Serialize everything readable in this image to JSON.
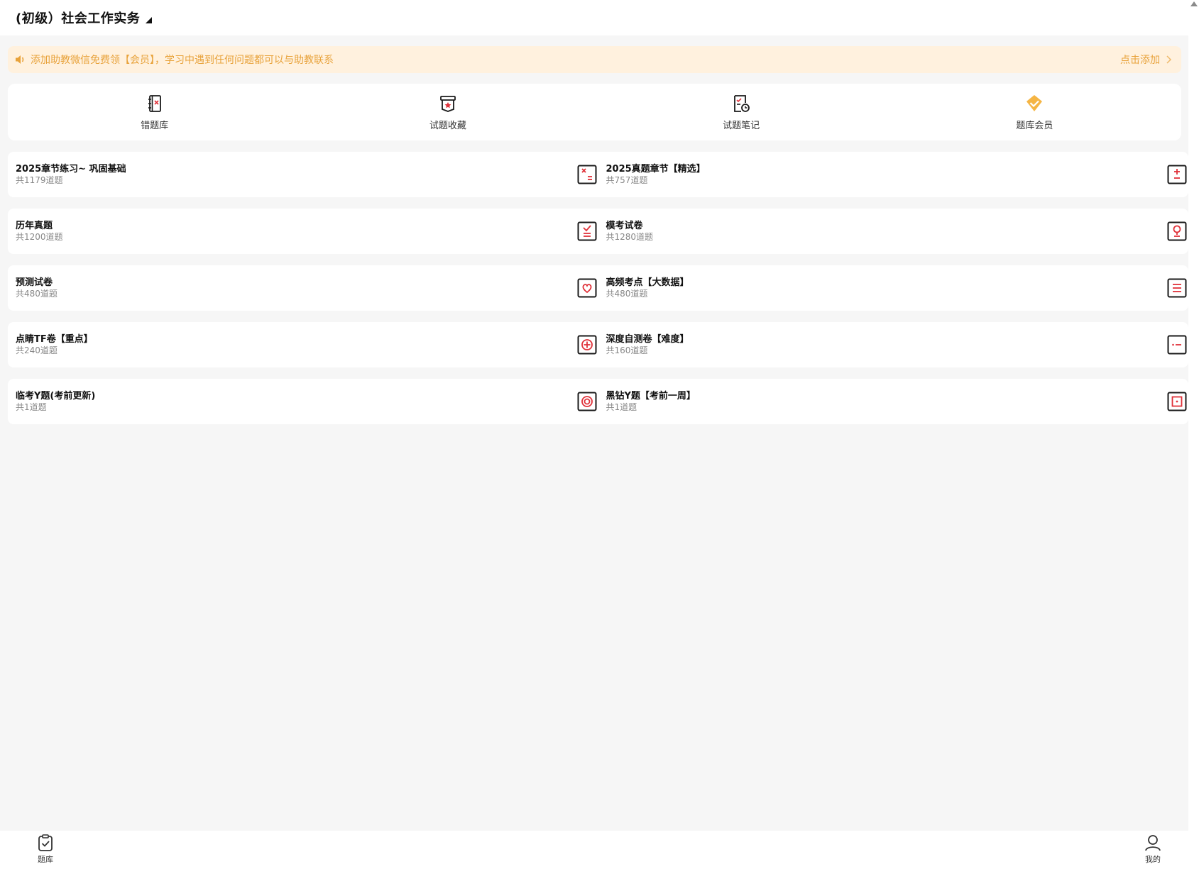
{
  "header": {
    "title": "(初级）社会工作实务"
  },
  "notice": {
    "text": "添加助教微信免费领【会员】，学习中遇到任何问题都可以与助教联系",
    "action_label": "点击添加"
  },
  "shortcuts": [
    {
      "label": "错题库",
      "icon": "error-notebook-icon"
    },
    {
      "label": "试题收藏",
      "icon": "favorite-box-icon"
    },
    {
      "label": "试题笔记",
      "icon": "note-clock-icon"
    },
    {
      "label": "题库会员",
      "icon": "crown-icon"
    }
  ],
  "banks": [
    {
      "name": "2025章节练习~ 巩固基础",
      "count": "共1179道题",
      "icon": "times-equals-icon"
    },
    {
      "name": "2025真题章节【精选】",
      "count": "共757道题",
      "icon": "plus-minus-icon"
    },
    {
      "name": "历年真题",
      "count": "共1200道题",
      "icon": "check-list-icon"
    },
    {
      "name": "模考试卷",
      "count": "共1280道题",
      "icon": "bulb-icon"
    },
    {
      "name": "预测试卷",
      "count": "共480道题",
      "icon": "heart-icon"
    },
    {
      "name": "高频考点【大数据】",
      "count": "共480道题",
      "icon": "menu-lines-icon"
    },
    {
      "name": "点睛TF卷【重点】",
      "count": "共240道题",
      "icon": "circle-plus-icon"
    },
    {
      "name": "深度自测卷【难度】",
      "count": "共160道题",
      "icon": "dot-dash-icon"
    },
    {
      "name": "临考Y题(考前更新)",
      "count": "共1道题",
      "icon": "target-icon"
    },
    {
      "name": "黑钻Y题【考前一周】",
      "count": "共1道题",
      "icon": "square-dot-icon"
    }
  ],
  "bottom_nav": [
    {
      "label": "题库",
      "icon": "clipboard-check-icon"
    },
    {
      "label": "我的",
      "icon": "user-icon"
    }
  ],
  "colors": {
    "accent": "#e8a23a",
    "icon_red": "#e0323a",
    "icon_dark": "#1a1a1a",
    "crown": "#f5b544",
    "notice_bg": "#fff1de"
  }
}
